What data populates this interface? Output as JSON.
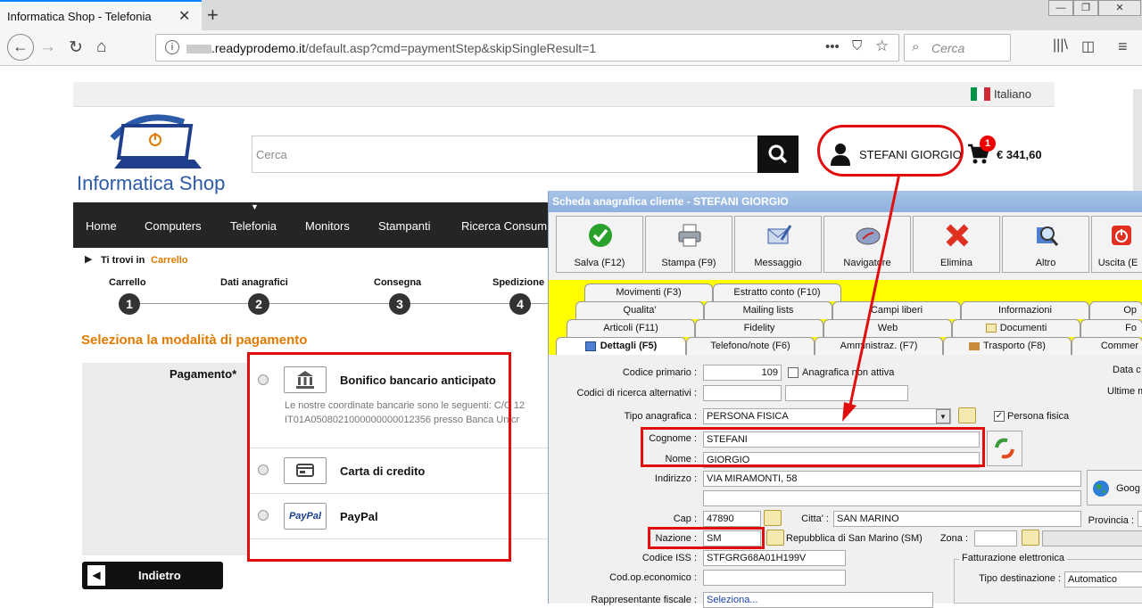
{
  "browser": {
    "tab_title": "Informatica Shop - Telefonia",
    "url_host": ".readyprodemo.it",
    "url_path": "/default.asp?cmd=paymentStep&skipSingleResult=1",
    "search_placeholder": "Cerca"
  },
  "site": {
    "language": "Italiano",
    "logo_text": "Informatica Shop",
    "search_placeholder": "Cerca",
    "user_name": "STEFANI GIORGIO",
    "cart_count": "1",
    "cart_total": "€ 341,60",
    "menu": [
      "Home",
      "Computers",
      "Telefonia",
      "Monitors",
      "Stampanti",
      "Ricerca Consum"
    ],
    "breadcrumb_label": "Ti trovi in",
    "breadcrumb_link": "Carrello",
    "steps": [
      {
        "label": "Carrello",
        "num": "1"
      },
      {
        "label": "Dati anagrafici",
        "num": "2"
      },
      {
        "label": "Consegna",
        "num": "3"
      },
      {
        "label": "Spedizione",
        "num": "4"
      }
    ],
    "payment_heading": "Seleziona la modalità di pagamento",
    "payment_label": "Pagamento*",
    "payment_options": [
      {
        "title": "Bonifico bancario anticipato",
        "desc_line1": "Le nostre coordinate bancarie sono le seguenti: C/C 12",
        "desc_line2": "IT01A0508021000000000012356 presso Banca Unicr"
      },
      {
        "title": "Carta di credito"
      },
      {
        "title": "PayPal",
        "logo": "PayPal"
      }
    ],
    "back_button": "Indietro"
  },
  "app": {
    "title": "Scheda anagrafica cliente - STEFANI GIORGIO",
    "toolbar": [
      "Salva (F12)",
      "Stampa (F9)",
      "Messaggio",
      "Navigatore",
      "Elimina",
      "Altro",
      "Uscita (E"
    ],
    "tabs_row1": [
      "Movimenti (F3)",
      "Estratto conto (F10)"
    ],
    "tabs_row2": [
      "Qualita'",
      "Mailing lists",
      "Campi liberi",
      "Informazioni",
      "Op"
    ],
    "tabs_row3": [
      "Articoli (F11)",
      "Fidelity",
      "Web",
      "Documenti",
      "Fo"
    ],
    "tabs_row4": [
      "Dettagli (F5)",
      "Telefono/note (F6)",
      "Amministraz. (F7)",
      "Trasporto (F8)",
      "Commer"
    ],
    "form": {
      "codice_primario_label": "Codice primario :",
      "codice_primario": "109",
      "anagrafica_non_attiva": "Anagrafica non attiva",
      "data_label": "Data c",
      "ultime_label": "Ultime m",
      "codici_ricerca_label": "Codici di ricerca alternativi :",
      "tipo_label": "Tipo anagrafica :",
      "tipo_value": "PERSONA FISICA",
      "persona_fisica": "Persona fisica",
      "cognome_label": "Cognome :",
      "cognome": "STEFANI",
      "nome_label": "Nome :",
      "nome": "GIORGIO",
      "indirizzo_label": "Indirizzo :",
      "indirizzo": "VIA MIRAMONTI, 58",
      "google_label": "Goog",
      "cap_label": "Cap :",
      "cap": "47890",
      "citta_label": "Citta' :",
      "citta": "SAN MARINO",
      "provincia_label": "Provincia :",
      "nazione_label": "Nazione :",
      "nazione": "SM",
      "nazione_desc": "Repubblica di San Marino (SM)",
      "zona_label": "Zona :",
      "codice_iss_label": "Codice ISS :",
      "codice_iss": "STFGRG68A01H199V",
      "fatt_label": "Fatturazione elettronica",
      "cod_op_label": "Cod.op.economico :",
      "tipo_dest_label": "Tipo destinazione :",
      "tipo_dest": "Automatico",
      "rapp_label": "Rappresentante fiscale :",
      "rapp_value": "Seleziona..."
    }
  },
  "colors": {
    "accent_orange": "#e07b00",
    "annotation_red": "#e20e0e",
    "app_tab_yellow": "#ffff00"
  }
}
